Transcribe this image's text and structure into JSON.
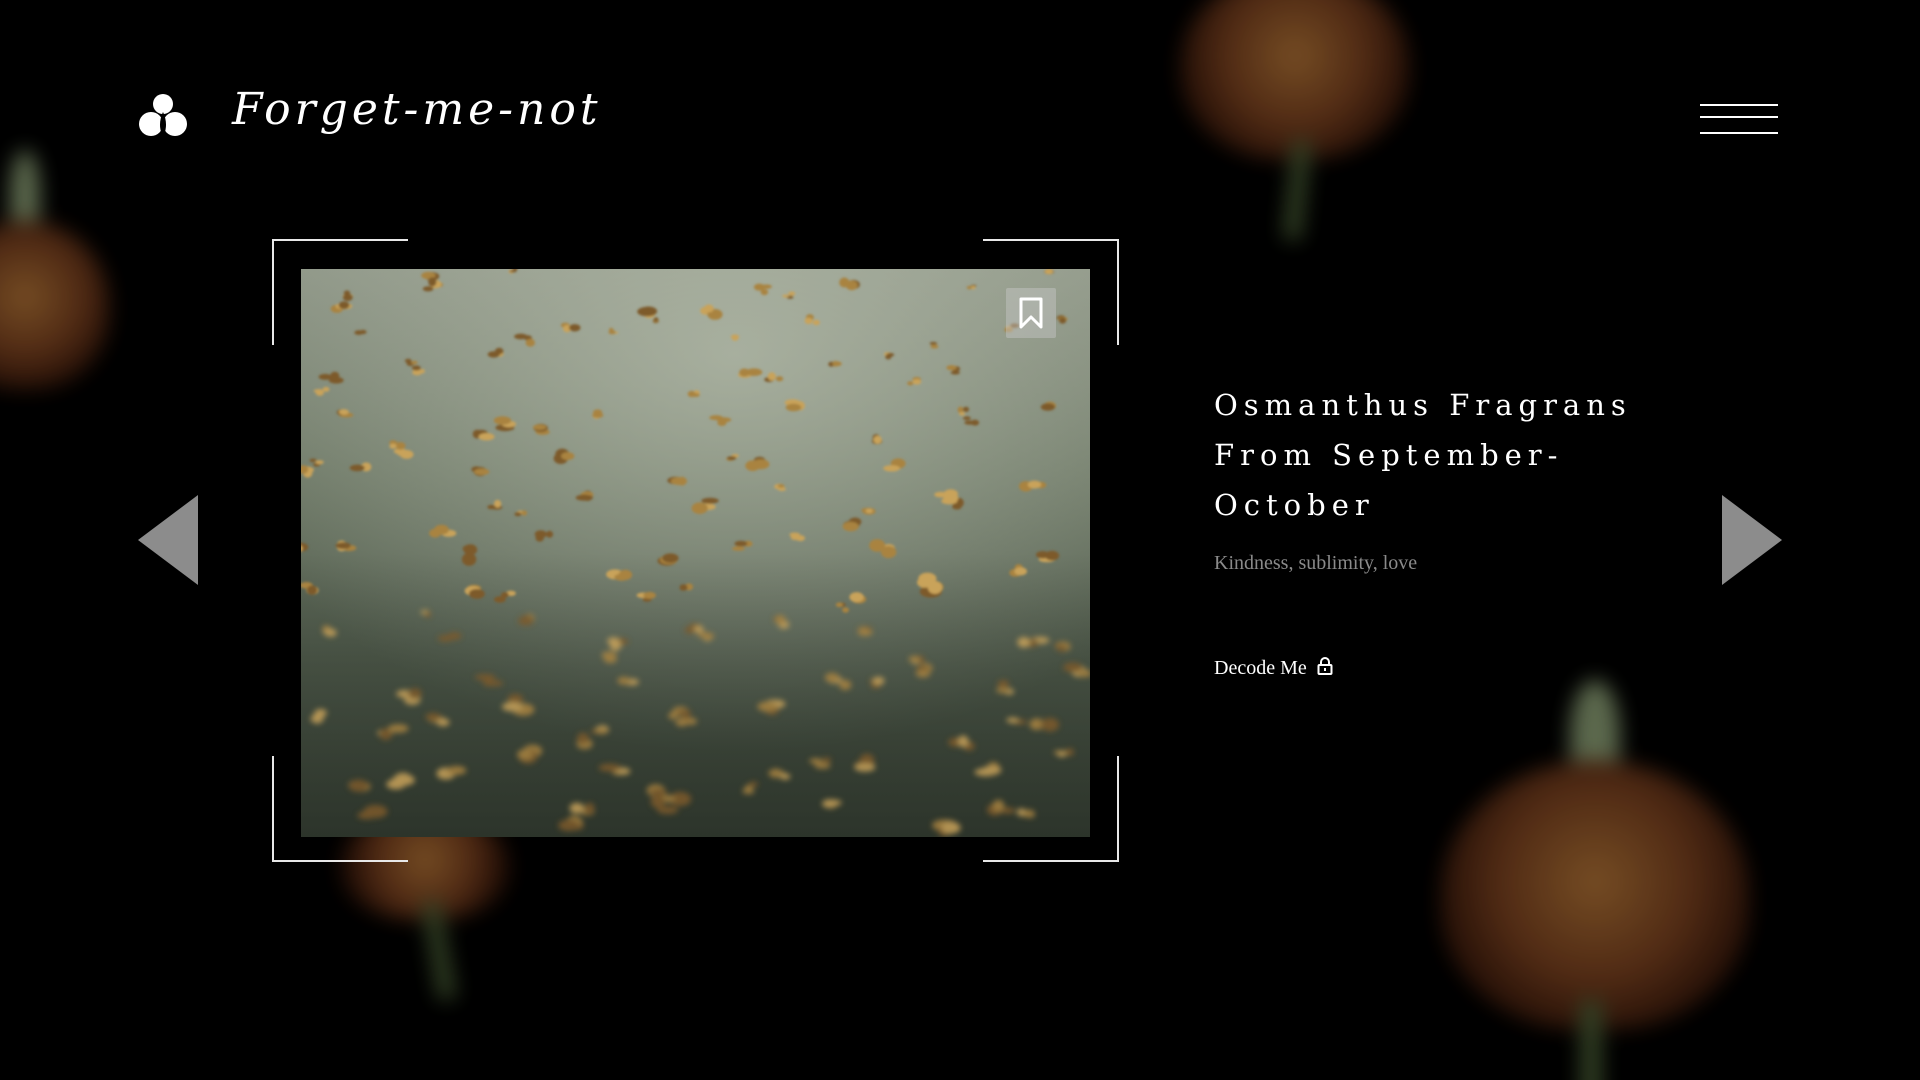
{
  "brand": {
    "name": "Forget-me-not",
    "logo_icon": "trefoil-drop-icon"
  },
  "header": {
    "menu_icon": "hamburger-menu-icon"
  },
  "slide": {
    "title_lines": [
      "Osmanthus Fragrans",
      "From September-",
      "October"
    ],
    "subtitle": "Kindness, sublimity, love",
    "cta_label": "Decode Me",
    "cta_icon": "lock-icon",
    "bookmark_icon": "bookmark-icon"
  },
  "navigation": {
    "prev_icon": "triangle-left-icon",
    "next_icon": "triangle-right-icon"
  },
  "colors": {
    "background": "#000000",
    "text_primary": "#ffffff",
    "text_muted": "#8a8a8a",
    "arrow": "#8c8c8c",
    "frame": "#e8e8e8"
  }
}
